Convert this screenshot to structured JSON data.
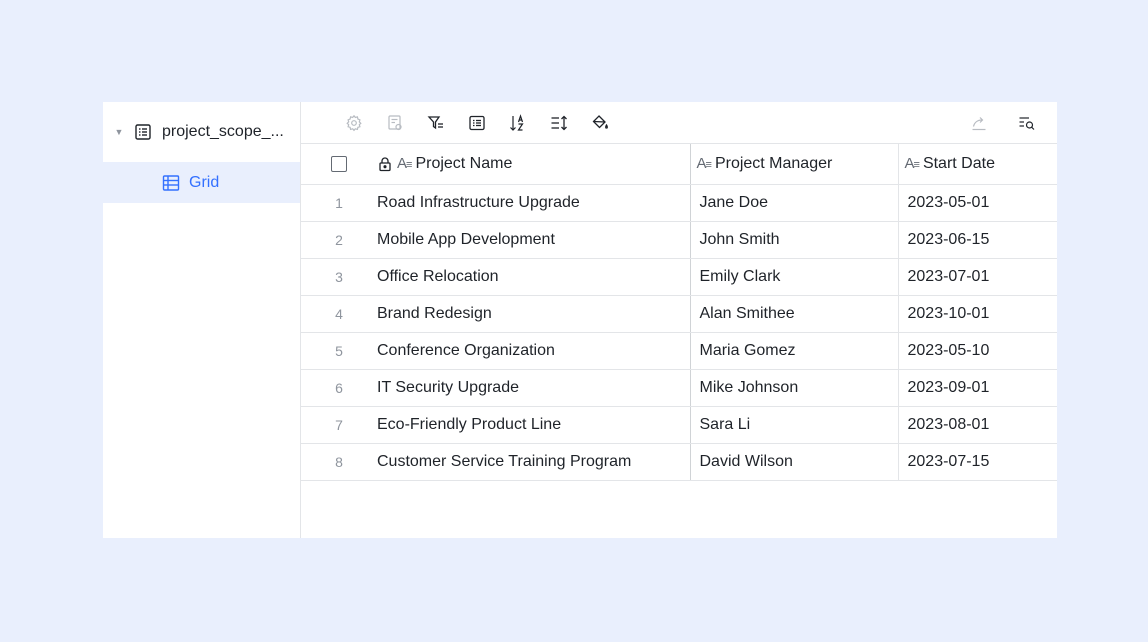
{
  "sidebar": {
    "table_name": "project_scope_...",
    "view_label": "Grid"
  },
  "toolbar": {
    "left_icons": [
      "settings-icon",
      "record-form-icon",
      "filter-icon",
      "group-icon",
      "sort-icon",
      "row-height-icon",
      "fill-color-icon"
    ],
    "right_icons": [
      "share-icon",
      "search-icon"
    ]
  },
  "grid": {
    "columns": {
      "name": "Project Name",
      "manager": "Project Manager",
      "start": "Start Date"
    },
    "rows": [
      {
        "num": "1",
        "name": "Road Infrastructure Upgrade",
        "manager": "Jane Doe",
        "start": "2023-05-01"
      },
      {
        "num": "2",
        "name": "Mobile App Development",
        "manager": "John Smith",
        "start": "2023-06-15"
      },
      {
        "num": "3",
        "name": "Office Relocation",
        "manager": "Emily Clark",
        "start": "2023-07-01"
      },
      {
        "num": "4",
        "name": "Brand Redesign",
        "manager": "Alan Smithee",
        "start": "2023-10-01"
      },
      {
        "num": "5",
        "name": "Conference Organization",
        "manager": "Maria Gomez",
        "start": "2023-05-10"
      },
      {
        "num": "6",
        "name": "IT Security Upgrade",
        "manager": "Mike Johnson",
        "start": "2023-09-01"
      },
      {
        "num": "7",
        "name": "Eco-Friendly Product Line",
        "manager": "Sara Li",
        "start": "2023-08-01"
      },
      {
        "num": "8",
        "name": "Customer Service Training Program",
        "manager": "David Wilson",
        "start": "2023-07-15"
      }
    ]
  },
  "colors": {
    "background": "#e9effd",
    "accent": "#3370ff",
    "selected_view_bg": "#e9effd"
  }
}
